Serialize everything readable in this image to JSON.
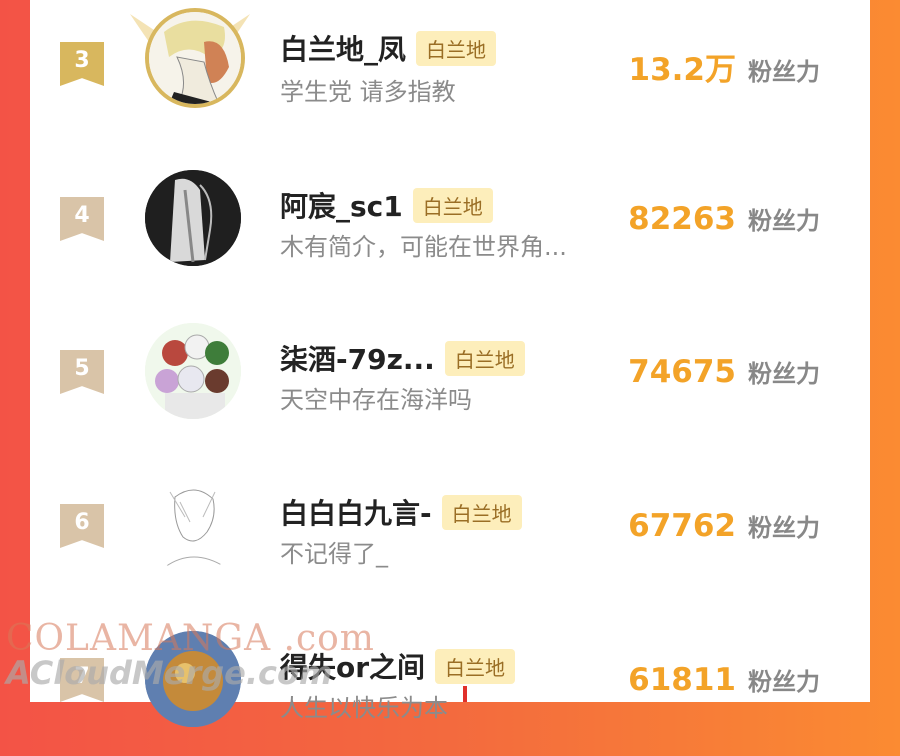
{
  "colors": {
    "accent": "#f3a328",
    "tag_bg": "#fdeebb",
    "rank_top": "#d8b75e",
    "rank_other": "#d9c4a8"
  },
  "rows": [
    {
      "rank": "3",
      "name": "白兰地_凤",
      "tag": "白兰地",
      "bio": "学生党 请多指教",
      "count": "13.2万",
      "unit": "粉丝力"
    },
    {
      "rank": "4",
      "name": "阿宸_sc1",
      "tag": "白兰地",
      "bio": "木有简介，可能在世界角...",
      "count": "82263",
      "unit": "粉丝力"
    },
    {
      "rank": "5",
      "name": "柒酒-79z...",
      "tag": "白兰地",
      "bio": "天空中存在海洋吗",
      "count": "74675",
      "unit": "粉丝力"
    },
    {
      "rank": "6",
      "name": "白白白九言-",
      "tag": "白兰地",
      "bio": "不记得了_",
      "count": "67762",
      "unit": "粉丝力"
    },
    {
      "rank": "7",
      "name": "得失or之间",
      "tag": "白兰地",
      "bio": "人生以快乐为本",
      "count": "61811",
      "unit": "粉丝力"
    }
  ],
  "watermark": {
    "line1": "COLAMANGA .com",
    "line2": "ACloudMerge.com"
  }
}
